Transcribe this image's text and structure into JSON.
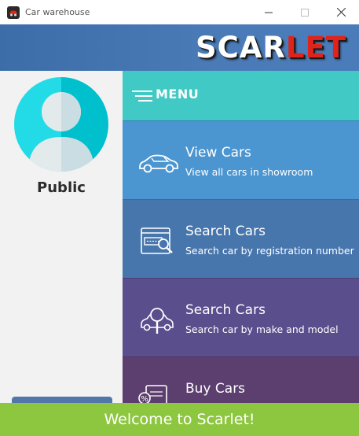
{
  "window": {
    "title": "Car warehouse",
    "controls": [
      "minimize-icon",
      "maximize-icon",
      "close-icon"
    ]
  },
  "header": {
    "brand_part1": "SCAR",
    "brand_part2": "LET",
    "brand_colors": {
      "primary": "#ffffff",
      "accent": "#e0231b"
    }
  },
  "user": {
    "name": "Public",
    "avatar_icon": "user-avatar-icon"
  },
  "menu": {
    "label": "MENU",
    "icon": "hamburger-icon",
    "items": [
      {
        "title": "View Cars",
        "subtitle": "View all cars in showroom",
        "icon": "car-icon",
        "color": "#4b95d0"
      },
      {
        "title": "Search Cars",
        "subtitle": "Search car by registration number",
        "icon": "registration-search-icon",
        "color": "#4776ad"
      },
      {
        "title": "Search Cars",
        "subtitle": "Search car by make and model",
        "icon": "car-search-icon",
        "color": "#5a4e8c"
      },
      {
        "title": "Buy Cars",
        "subtitle": "",
        "icon": "buy-car-icon",
        "color": "#5c3f6e"
      }
    ]
  },
  "footer": {
    "message": "Welcome to Scarlet!",
    "color": "#8dc63f"
  }
}
